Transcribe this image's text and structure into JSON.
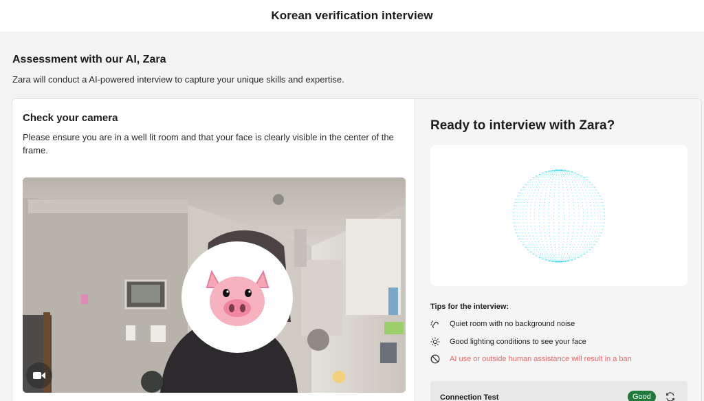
{
  "header": {
    "title": "Korean verification interview"
  },
  "intro": {
    "title": "Assessment with our AI, Zara",
    "description": "Zara will conduct a AI-powered interview to capture your unique skills and expertise."
  },
  "camera": {
    "title": "Check your camera",
    "description": "Please ensure you are in a well lit room and that your face is clearly visible in the center of the frame.",
    "toggle_icon": "video-camera-icon",
    "face_overlay": "pig-face-emoji"
  },
  "ready": {
    "title": "Ready to interview with Zara?",
    "orb_color": "#22d3ee"
  },
  "tips": {
    "heading": "Tips for the interview:",
    "items": [
      {
        "icon": "ear-icon",
        "text": "Quiet room with no background noise"
      },
      {
        "icon": "sun-icon",
        "text": "Good lighting conditions to see your face"
      },
      {
        "icon": "ban-icon",
        "text": "AI use or outside human assistance will result in a ban",
        "warning": true
      }
    ]
  },
  "connection": {
    "label": "Connection Test",
    "status": "Good",
    "status_color": "#1f7a3b",
    "refresh_icon": "refresh-icon"
  }
}
